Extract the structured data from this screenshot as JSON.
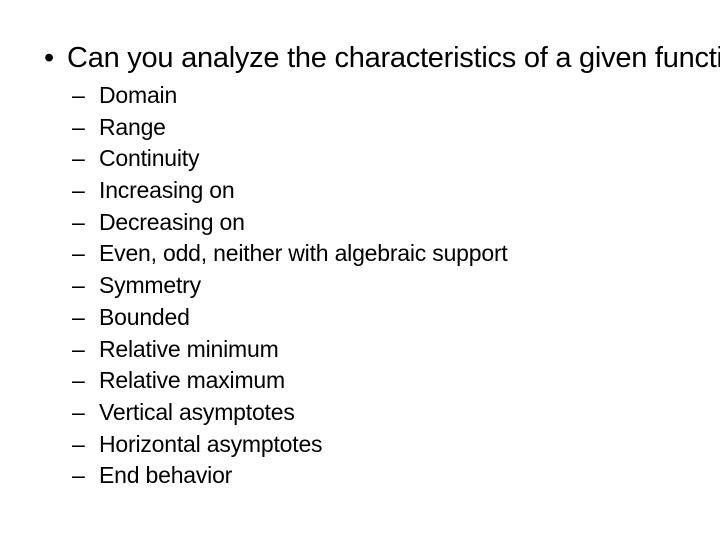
{
  "slide": {
    "background_color": "#ffffff",
    "text_color": "#000000",
    "level1": {
      "marker": "•",
      "text": "Can you analyze the characteristics of a given function?"
    },
    "level2": {
      "marker": "–",
      "items": [
        {
          "label": "Domain"
        },
        {
          "label": "Range"
        },
        {
          "label": "Continuity"
        },
        {
          "label": "Increasing on"
        },
        {
          "label": "Decreasing on"
        },
        {
          "label": "Even, odd, neither with algebraic support"
        },
        {
          "label": "Symmetry"
        },
        {
          "label": "Bounded"
        },
        {
          "label": "Relative minimum"
        },
        {
          "label": "Relative maximum"
        },
        {
          "label": "Vertical asymptotes"
        },
        {
          "label": "Horizontal asymptotes"
        },
        {
          "label": "End behavior"
        }
      ]
    }
  }
}
